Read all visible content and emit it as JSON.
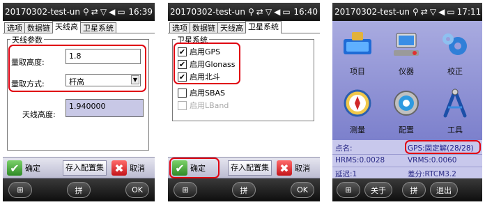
{
  "screens": [
    {
      "statusbar": {
        "title": "20170302-test-un",
        "time": "16:39"
      },
      "tabs": [
        "选项",
        "数据链",
        "天线高",
        "卫星系统"
      ],
      "active_tab": 2,
      "group_title": "天线参数",
      "fields": {
        "measure_height_label": "量取高度:",
        "measure_height_value": "1.8",
        "measure_method_label": "量取方式:",
        "measure_method_value": "杆高",
        "antenna_height_label": "天线高度:",
        "antenna_height_value": "1.940000"
      },
      "buttons": {
        "confirm": "确定",
        "save_config": "存入配置集",
        "cancel": "取消"
      },
      "softkeys": {
        "input_method": "拼",
        "ok": "OK"
      }
    },
    {
      "statusbar": {
        "title": "20170302-test-un",
        "time": "16:40"
      },
      "tabs": [
        "选项",
        "数据链",
        "天线高",
        "卫星系统"
      ],
      "active_tab": 3,
      "group_title": "卫星系统",
      "checkboxes": [
        {
          "label": "启用GPS",
          "checked": true,
          "enabled": true
        },
        {
          "label": "启用Glonass",
          "checked": true,
          "enabled": true
        },
        {
          "label": "启用北斗",
          "checked": true,
          "enabled": true
        },
        {
          "label": "启用SBAS",
          "checked": false,
          "enabled": true
        },
        {
          "label": "启用LBand",
          "checked": false,
          "enabled": false
        }
      ],
      "buttons": {
        "confirm": "确定",
        "save_config": "存入配置集",
        "cancel": "取消"
      },
      "softkeys": {
        "input_method": "拼",
        "ok": "OK"
      }
    },
    {
      "statusbar": {
        "title": "20170302-test-un",
        "time": "17:11"
      },
      "tiles": [
        {
          "label": "项目",
          "icon": "project-icon"
        },
        {
          "label": "仪器",
          "icon": "instrument-icon"
        },
        {
          "label": "校正",
          "icon": "calibration-icon"
        },
        {
          "label": "测量",
          "icon": "survey-icon"
        },
        {
          "label": "配置",
          "icon": "config-icon"
        },
        {
          "label": "工具",
          "icon": "tools-icon"
        }
      ],
      "info": {
        "point_name": "点名:",
        "gps_status": "GPS:固定解(28/28)",
        "hrms": "HRMS:0.0028",
        "vrms": "VRMS:0.0060",
        "latency": "延迟:1",
        "diff": "差分:RTCM3.2"
      },
      "softkeys": {
        "about": "关于",
        "input_method": "拼",
        "exit": "退出"
      }
    }
  ],
  "colors": {
    "highlight_red": "#e00010",
    "launcher_bg": "#9a9ddb",
    "info_text": "#2a2a86",
    "readonly_field": "#c8c8e6"
  }
}
